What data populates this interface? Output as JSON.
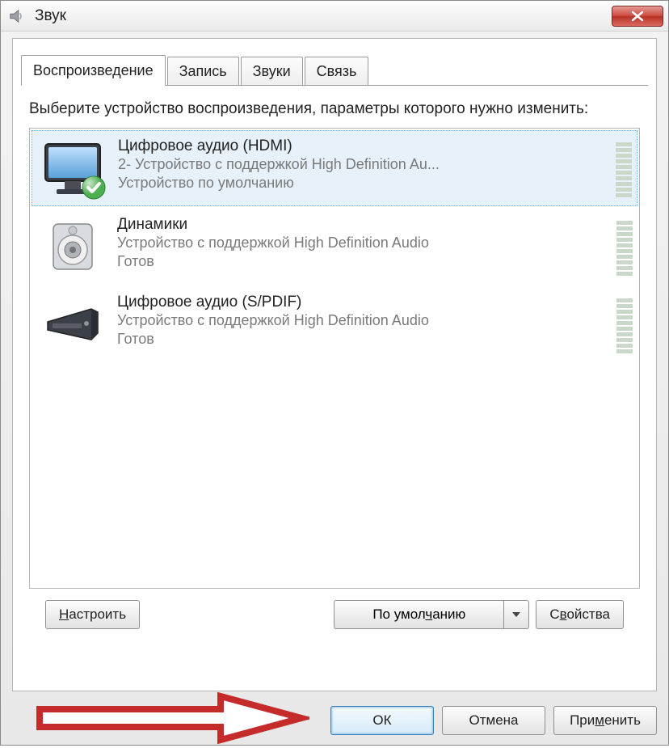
{
  "window": {
    "title": "Звук"
  },
  "tabs": [
    {
      "label": "Воспроизведение",
      "active": true
    },
    {
      "label": "Запись",
      "active": false
    },
    {
      "label": "Звуки",
      "active": false
    },
    {
      "label": "Связь",
      "active": false
    }
  ],
  "prompt_text": "Выберите устройство воспроизведения, параметры которого нужно изменить:",
  "devices": [
    {
      "name": "Цифровое аудио (HDMI)",
      "line2": "2- Устройство с поддержкой High Definition Au...",
      "line3": "Устройство по умолчанию",
      "icon": "monitor",
      "selected": true,
      "default": true
    },
    {
      "name": "Динамики",
      "line2": "Устройство с поддержкой High Definition Audio",
      "line3": "Готов",
      "icon": "speaker",
      "selected": false,
      "default": false
    },
    {
      "name": "Цифровое аудио (S/PDIF)",
      "line2": "Устройство с поддержкой High Definition Audio",
      "line3": "Готов",
      "icon": "spdif",
      "selected": false,
      "default": false
    }
  ],
  "buttons": {
    "configure": "Настроить",
    "set_default": "По умолчанию",
    "properties": "Свойства",
    "ok": "ОК",
    "cancel": "Отмена",
    "apply": "Применить"
  }
}
